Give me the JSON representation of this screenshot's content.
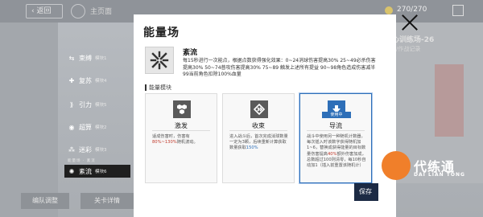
{
  "background": {
    "back_label": "返回",
    "home_label": "主页面",
    "stamina": "270/270",
    "stage_title": "核心训练场-26",
    "stage_sub": "阵容/作战记录",
    "btn_left": "编队调整",
    "btn_right": "关卡详情"
  },
  "modal": {
    "title": "能量场",
    "close_label": "×",
    "selected_mode": {
      "name": "紊流",
      "description": "每15秒进行一次能点，根据点数获得强化效果：0~24消球伤害提高30% 25~49必杀伤害提高30% 50~74普攻伤害提高30% 75~89 触发上述所有提益 90~98角色造成伤害减半 99当前角色扣除100%血量"
    },
    "section_label": "能量模块",
    "cards": [
      {
        "name": "激发",
        "description": "适成伤害时，伤害有80%~130%随机波动。",
        "highlight": "80%~130%",
        "badge": ""
      },
      {
        "name": "收束",
        "description": "进入战斗后，首次完成消球数量一定为3颗，后续重新计算获取数量获取150%",
        "highlight": "150%",
        "badge": ""
      },
      {
        "name": "导流",
        "description": "战斗中使用另一种随机计数器，每次插入时该数字获得随机加1~6，替换成获得能量的目标数量伤害提高40%额外伤害加成，总数超过100则清零，每10秒自动加1（插入前重置该随机计）",
        "highlight": "40%",
        "badge": "使用中"
      }
    ]
  },
  "mode_list": {
    "items": [
      {
        "label": "束缚",
        "level": "模块1",
        "icon": "bind-icon"
      },
      {
        "label": "复苏",
        "level": "模块4",
        "icon": "plus-icon"
      },
      {
        "label": "引力",
        "level": "模块5",
        "icon": "gravity-icon"
      },
      {
        "label": "超算",
        "level": "模块2",
        "icon": "compute-icon"
      },
      {
        "label": "迷彩",
        "level": "模块3",
        "icon": "camo-icon"
      },
      {
        "label": "紊流",
        "level": "模块6",
        "icon": "turbulence-icon"
      }
    ],
    "caption": "能量场 · 紊流"
  },
  "save_label": "保存",
  "logo": {
    "cn": "代练通",
    "en": "DAI LIAN TONG"
  },
  "colors": {
    "accent": "#2e6fb8",
    "highlight": "#c0392b",
    "active_item": "#1f1f1f",
    "logo": "#f07f2a"
  }
}
